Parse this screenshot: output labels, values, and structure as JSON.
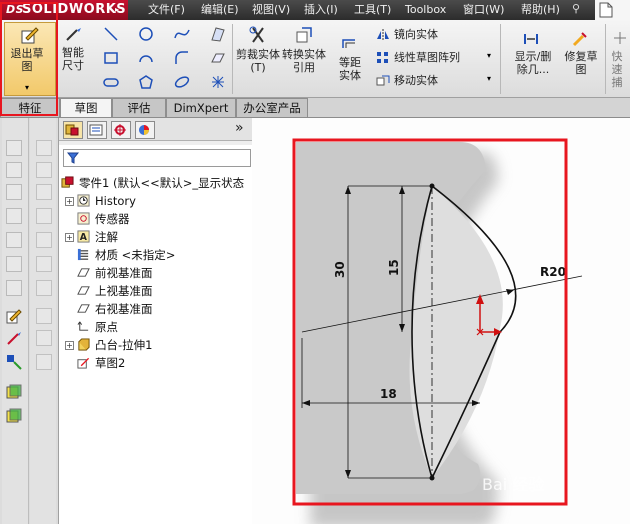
{
  "app": {
    "logo_text": "SOLIDWORKS",
    "logo_prefix": "DS"
  },
  "menu": [
    "文件(F)",
    "编辑(E)",
    "视图(V)",
    "插入(I)",
    "工具(T)",
    "Toolbox",
    "窗口(W)",
    "帮助(H)"
  ],
  "ribbon": {
    "exit_sketch": "退出草图",
    "smart_dim": "智能尺寸",
    "trim": "剪裁实体(T)",
    "convert": "转换实体引用",
    "offset": "等距实体",
    "mirror": "镜向实体",
    "linear_pattern": "线性草图阵列",
    "move": "移动实体",
    "display_delete": "显示/删除几...",
    "repair": "修复草图",
    "quick_snaps": "快速捕捉"
  },
  "tabs": [
    {
      "label": "特征",
      "active": false
    },
    {
      "label": "草图",
      "active": true
    },
    {
      "label": "评估",
      "active": false
    },
    {
      "label": "DimXpert",
      "active": false
    },
    {
      "label": "办公室产品",
      "active": false
    }
  ],
  "tree": {
    "expand_label": "»",
    "root": "零件1 (默认<<默认>_显示状态",
    "items": [
      {
        "label": "History",
        "expander": "+"
      },
      {
        "label": "传感器",
        "expander": ""
      },
      {
        "label": "注解",
        "expander": "+"
      },
      {
        "label": "材质 <未指定>",
        "expander": ""
      },
      {
        "label": "前视基准面",
        "expander": ""
      },
      {
        "label": "上视基准面",
        "expander": ""
      },
      {
        "label": "右视基准面",
        "expander": ""
      },
      {
        "label": "原点",
        "expander": ""
      },
      {
        "label": "凸台-拉伸1",
        "expander": "+"
      },
      {
        "label": "草图2",
        "expander": ""
      }
    ]
  },
  "sketch": {
    "dim_30": "30",
    "dim_15": "15",
    "dim_18": "18",
    "dim_r20": "R20"
  },
  "colors": {
    "highlight": "#e8161f",
    "origin": "#d01010",
    "ribbon_bg": "#e9e9e9"
  },
  "watermark": "Bai 经验"
}
